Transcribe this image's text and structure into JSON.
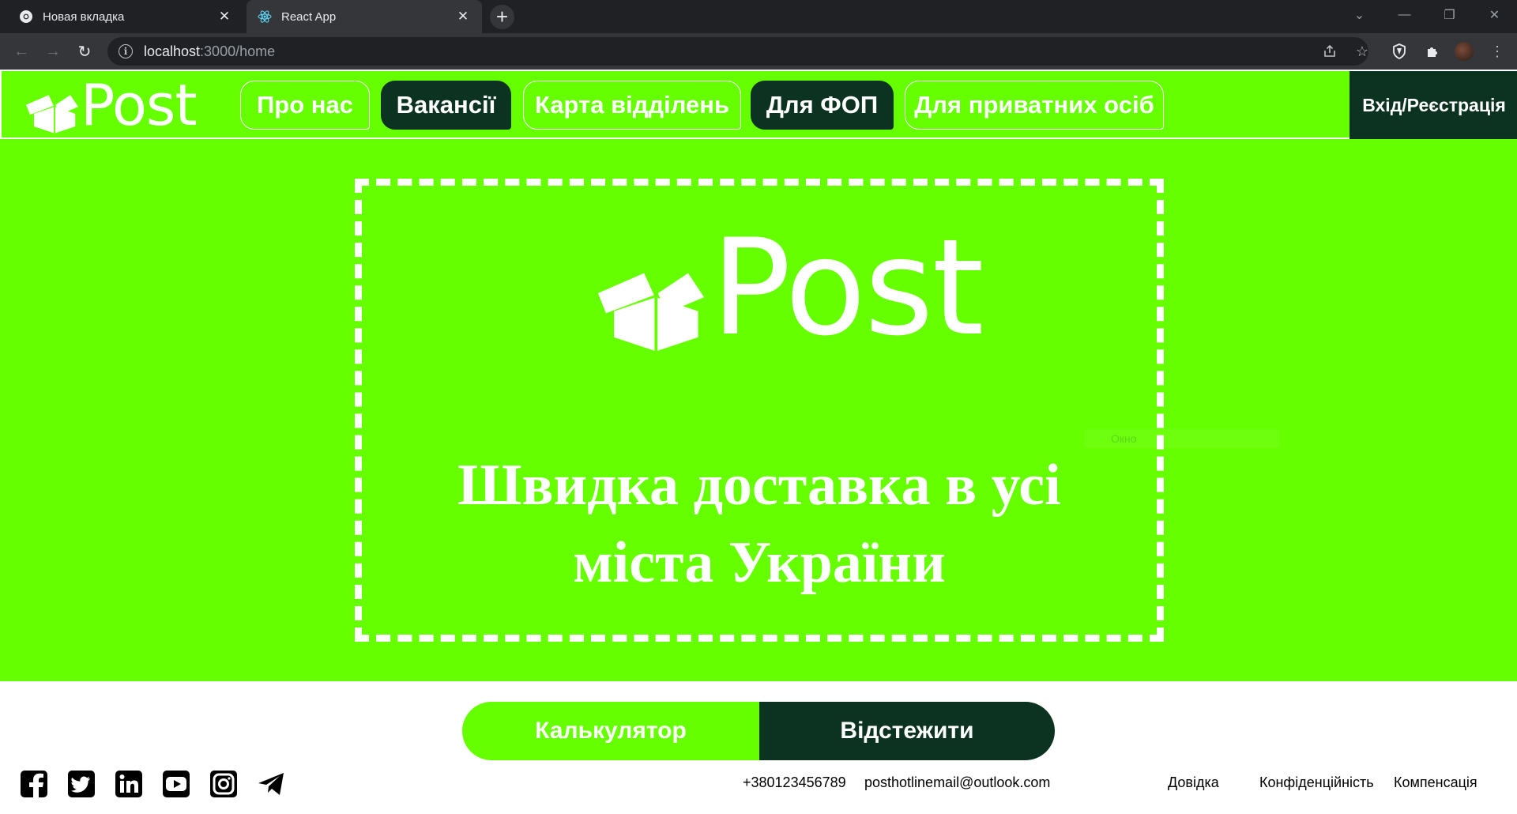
{
  "browser": {
    "tabs": [
      {
        "title": "Новая вкладка",
        "icon": "chrome-icon",
        "active": false
      },
      {
        "title": "React App",
        "icon": "react-icon",
        "active": true
      }
    ],
    "url_host": "localhost",
    "url_rest": ":3000/home"
  },
  "header": {
    "logo_text": "Post",
    "nav": [
      {
        "label": "Про нас",
        "style": "outline"
      },
      {
        "label": "Вакансії",
        "style": "dark"
      },
      {
        "label": "Карта відділень",
        "style": "outline"
      },
      {
        "label": "Для ФОП",
        "style": "dark"
      },
      {
        "label": "Для приватних осіб",
        "style": "outline"
      }
    ],
    "login_label": "Вхід/Реєстрація"
  },
  "hero": {
    "logo_text": "Post",
    "title_line1": "Швидка доставка в усі",
    "title_line2": "міста України",
    "ghost_text": "Окно"
  },
  "actions": {
    "calculator_label": "Калькулятор",
    "track_label": "Відстежити"
  },
  "footer": {
    "social": [
      "facebook-icon",
      "twitter-icon",
      "linkedin-icon",
      "youtube-icon",
      "instagram-icon",
      "telegram-icon"
    ],
    "phone": "+380123456789",
    "email": "posthotlinemail@outlook.com",
    "links": [
      "Довідка",
      "Конфіденційність",
      "Компенсація"
    ]
  },
  "colors": {
    "brand_green": "#66ff00",
    "dark_green": "#0c3322",
    "white": "#ffffff"
  }
}
